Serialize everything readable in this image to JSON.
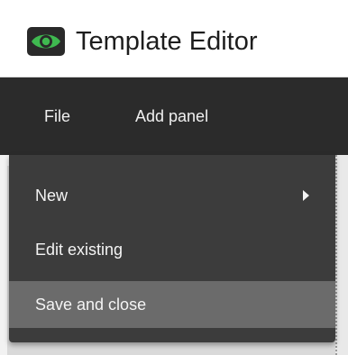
{
  "window": {
    "title": "Template Editor",
    "icon": "eye-icon",
    "accent": "#3fb950"
  },
  "menubar": {
    "items": [
      {
        "label": "File"
      },
      {
        "label": "Add panel"
      }
    ]
  },
  "file_menu": {
    "items": [
      {
        "label": "New",
        "has_submenu": true
      },
      {
        "label": "Edit existing"
      },
      {
        "label": "Save and close",
        "highlighted": true
      }
    ]
  },
  "colors": {
    "menubar_bg": "#2b2b2b",
    "menu_bg": "#3c3c3c",
    "menu_highlight": "#6b6b6b",
    "menu_text": "#f4f4f4"
  }
}
